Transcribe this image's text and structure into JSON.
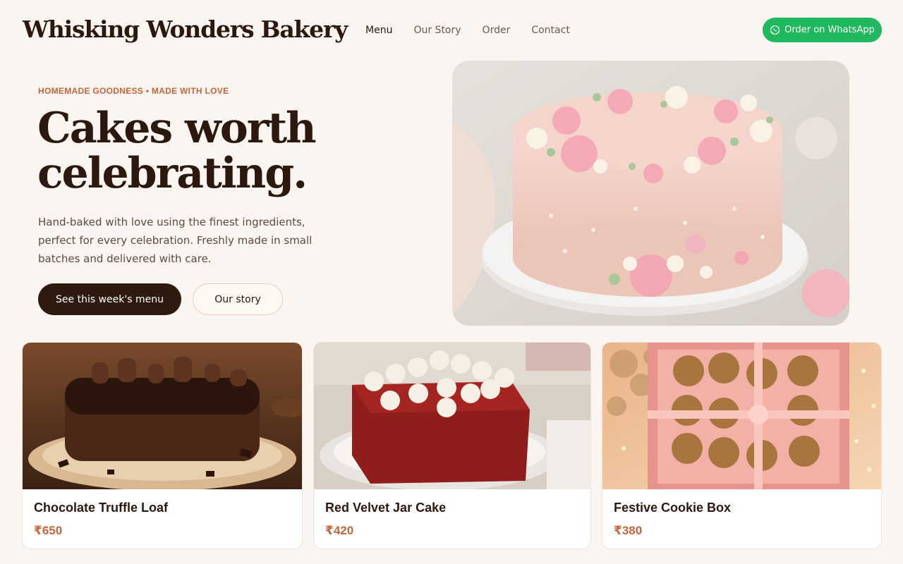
{
  "brand": {
    "name": "Whisking Wonders Bakery"
  },
  "nav": {
    "items": [
      {
        "label": "Menu",
        "active": true
      },
      {
        "label": "Our Story",
        "active": false
      },
      {
        "label": "Order",
        "active": false
      },
      {
        "label": "Contact",
        "active": false
      }
    ]
  },
  "header": {
    "cta_label": "Order on WhatsApp",
    "cta_icon": "whatsapp-icon"
  },
  "hero": {
    "eyebrow": "HOMEMADE GOODNESS • MADE WITH LOVE",
    "headline_line1": "Cakes worth",
    "headline_line2": "celebrating.",
    "description_line1": "Hand-baked with love using the finest ingredients,",
    "description_line2": "perfect for every celebration. Freshly made in small",
    "description_line3": "batches and delivered with care.",
    "primary_button": "See this week's menu",
    "secondary_button": "Our story",
    "image": "floral-pink-cake-photo"
  },
  "products": [
    {
      "name": "Chocolate Truffle Loaf",
      "price": "₹650",
      "image": "chocolate-loaf-photo"
    },
    {
      "name": "Red Velvet Jar Cake",
      "price": "₹420",
      "image": "red-velvet-cake-photo"
    },
    {
      "name": "Festive Cookie Box",
      "price": "₹380",
      "image": "cookie-box-photo"
    }
  ],
  "colors": {
    "background": "#fbf5f1",
    "accent": "#c4653c",
    "dark_brown": "#2f1a0f",
    "whatsapp_green": "#20b85f"
  }
}
